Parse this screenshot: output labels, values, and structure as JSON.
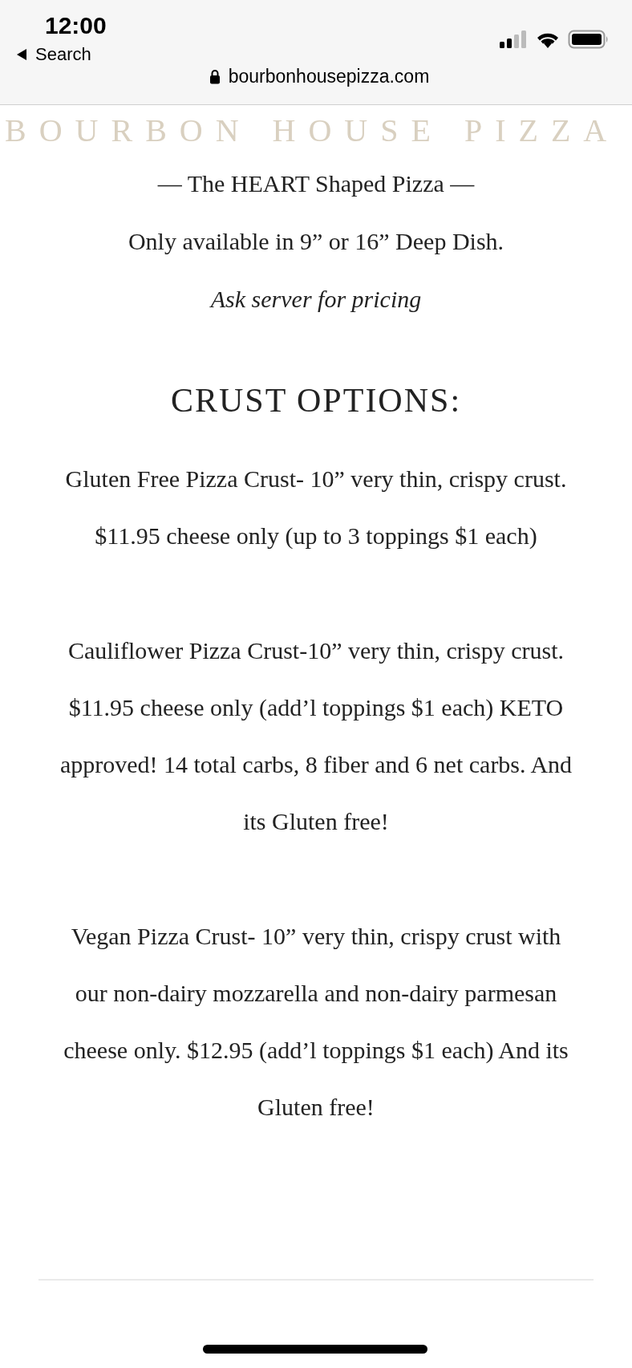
{
  "status_bar": {
    "time": "12:00",
    "back_label": "Search"
  },
  "address_bar": {
    "url": "bourbonhousepizza.com"
  },
  "site_title": "BOURBON HOUSE PIZZA",
  "intro": [
    {
      "text": "—  The HEART Shaped Pizza  —",
      "kind": "plain"
    },
    {
      "text": "Only available in 9” or 16” Deep Dish.",
      "kind": "plain"
    },
    {
      "text": "Ask server for pricing",
      "kind": "italic"
    }
  ],
  "section": {
    "heading": "CRUST OPTIONS:",
    "paragraphs": [
      "Gluten Free Pizza Crust- 10” very thin, crispy crust. $11.95 cheese only (up to 3 toppings $1 each)",
      "Cauliflower Pizza Crust-10” very thin, crispy crust. $11.95 cheese only (add’l toppings $1 each) KETO approved! 14 total carbs, 8 fiber and 6 net carbs. And its Gluten free!",
      "Vegan Pizza Crust- 10” very thin, crispy crust with our non-dairy mozzarella and non-dairy parmesan cheese only. $12.95 (add’l toppings $1 each) And its Gluten free!"
    ]
  }
}
